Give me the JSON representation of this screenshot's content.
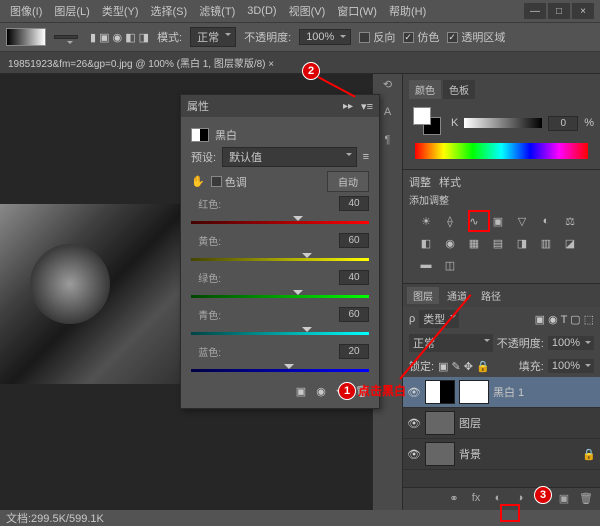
{
  "menu": {
    "image": "图像(I)",
    "layer": "图层(L)",
    "type": "类型(Y)",
    "select": "选择(S)",
    "filter": "滤镜(T)",
    "threeD": "3D(D)",
    "view": "视图(V)",
    "window": "窗口(W)",
    "help": "帮助(H)"
  },
  "optbar": {
    "mode_lbl": "模式:",
    "mode_val": "正常",
    "opacity_lbl": "不透明度:",
    "opacity_val": "100%",
    "reverse": "反向",
    "dither": "仿色",
    "transparency": "透明区域"
  },
  "doc_tab": "19851923&fm=26&gp=0.jpg @ 100% (黑白 1, 图层蒙版/8) ×",
  "props": {
    "panel": "属性",
    "name": "黑白",
    "preset_lbl": "预设:",
    "preset_val": "默认值",
    "tint": "色调",
    "auto": "自动",
    "sliders": [
      {
        "label": "红色:",
        "value": 40,
        "grad": "linear-gradient(90deg,#400,#f00)"
      },
      {
        "label": "黄色:",
        "value": 60,
        "grad": "linear-gradient(90deg,#440,#ff0)"
      },
      {
        "label": "绿色:",
        "value": 40,
        "grad": "linear-gradient(90deg,#040,#0f0)"
      },
      {
        "label": "青色:",
        "value": 60,
        "grad": "linear-gradient(90deg,#044,#0ff)"
      },
      {
        "label": "蓝色:",
        "value": 20,
        "grad": "linear-gradient(90deg,#004,#00f)"
      }
    ]
  },
  "color": {
    "tab1": "颜色",
    "tab2": "色板",
    "k": "K",
    "k_val": "0",
    "pct": "%"
  },
  "adj": {
    "tab1": "调整",
    "tab2": "样式",
    "title": "添加调整"
  },
  "layers": {
    "tab1": "图层",
    "tab2": "通道",
    "tab3": "路径",
    "kind": "类型",
    "blend": "正常",
    "opacity_lbl": "不透明度:",
    "opacity_val": "100%",
    "lock_lbl": "锁定:",
    "fill_lbl": "填充:",
    "fill_val": "100%",
    "rows": [
      {
        "name": "黑白 1",
        "adj": true,
        "sel": true
      },
      {
        "name": "图层",
        "adj": false,
        "sel": false
      },
      {
        "name": "背景",
        "adj": false,
        "sel": false,
        "lock": true
      }
    ]
  },
  "status": "文档:299.5K/599.1K",
  "anno": {
    "c1": "1",
    "c2": "2",
    "c3": "3",
    "text": "点击黑白"
  }
}
